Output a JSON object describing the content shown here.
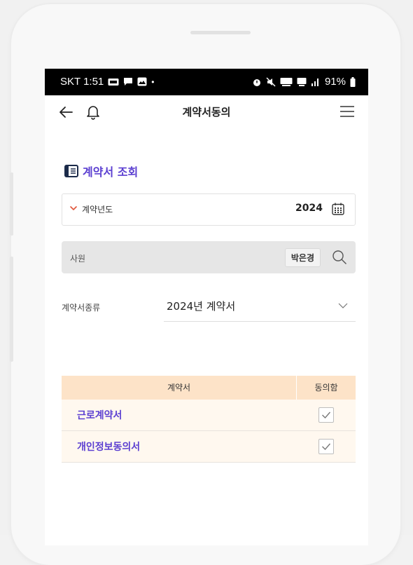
{
  "statusbar": {
    "carrier_time": "SKT 1:51",
    "battery": "91%",
    "icons": [
      "live-icon",
      "chat-icon",
      "gallery-icon",
      "alarm-icon",
      "mute-icon",
      "hd-voice-icon",
      "5g-icon",
      "signal-icon",
      "battery-icon"
    ]
  },
  "header": {
    "title": "계약서동의"
  },
  "section": {
    "title": "계약서 조회"
  },
  "filters": {
    "year_label": "계약년도",
    "year_value": "2024",
    "employee_label": "사원",
    "employee_value": "박은경",
    "type_label": "계약서종류",
    "type_value": "2024년 계약서"
  },
  "table": {
    "headers": [
      "계약서",
      "동의함"
    ],
    "rows": [
      {
        "name": "근로계약서",
        "agreed": true
      },
      {
        "name": "개인정보동의서",
        "agreed": true
      }
    ]
  },
  "colors": {
    "accent": "#5b3fd1",
    "table_header": "#fde3c8",
    "table_row": "#fff8ef",
    "required_mark": "#e0553a"
  }
}
